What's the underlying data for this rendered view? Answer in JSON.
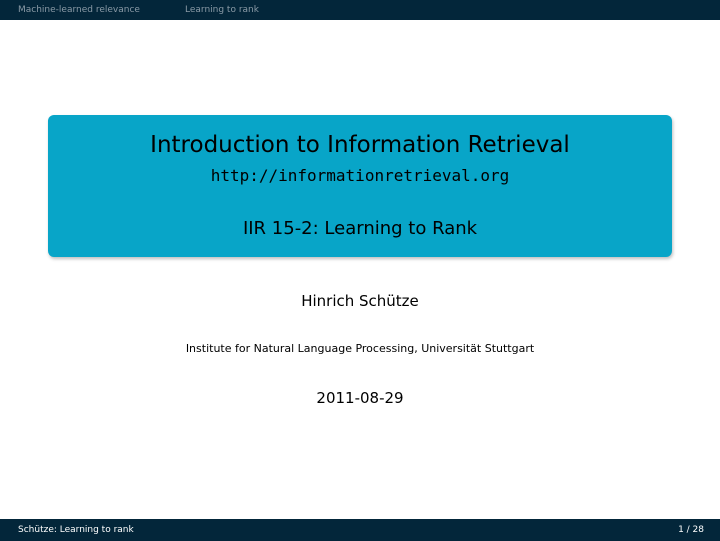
{
  "header": {
    "nav_items": [
      "Machine-learned relevance",
      "Learning to rank"
    ]
  },
  "title_block": {
    "title": "Introduction to Information Retrieval",
    "url": "http://informationretrieval.org",
    "subtitle": "IIR 15-2: Learning to Rank"
  },
  "author": "Hinrich Schütze",
  "institute": "Institute for Natural Language Processing, Universität Stuttgart",
  "date": "2011-08-29",
  "footer": {
    "left": "Schütze: Learning to rank",
    "page": "1 / 28"
  },
  "colors": {
    "bar_background": "#03263a",
    "title_box": "#08a5c8",
    "nav_text": "#8a9aa6"
  }
}
